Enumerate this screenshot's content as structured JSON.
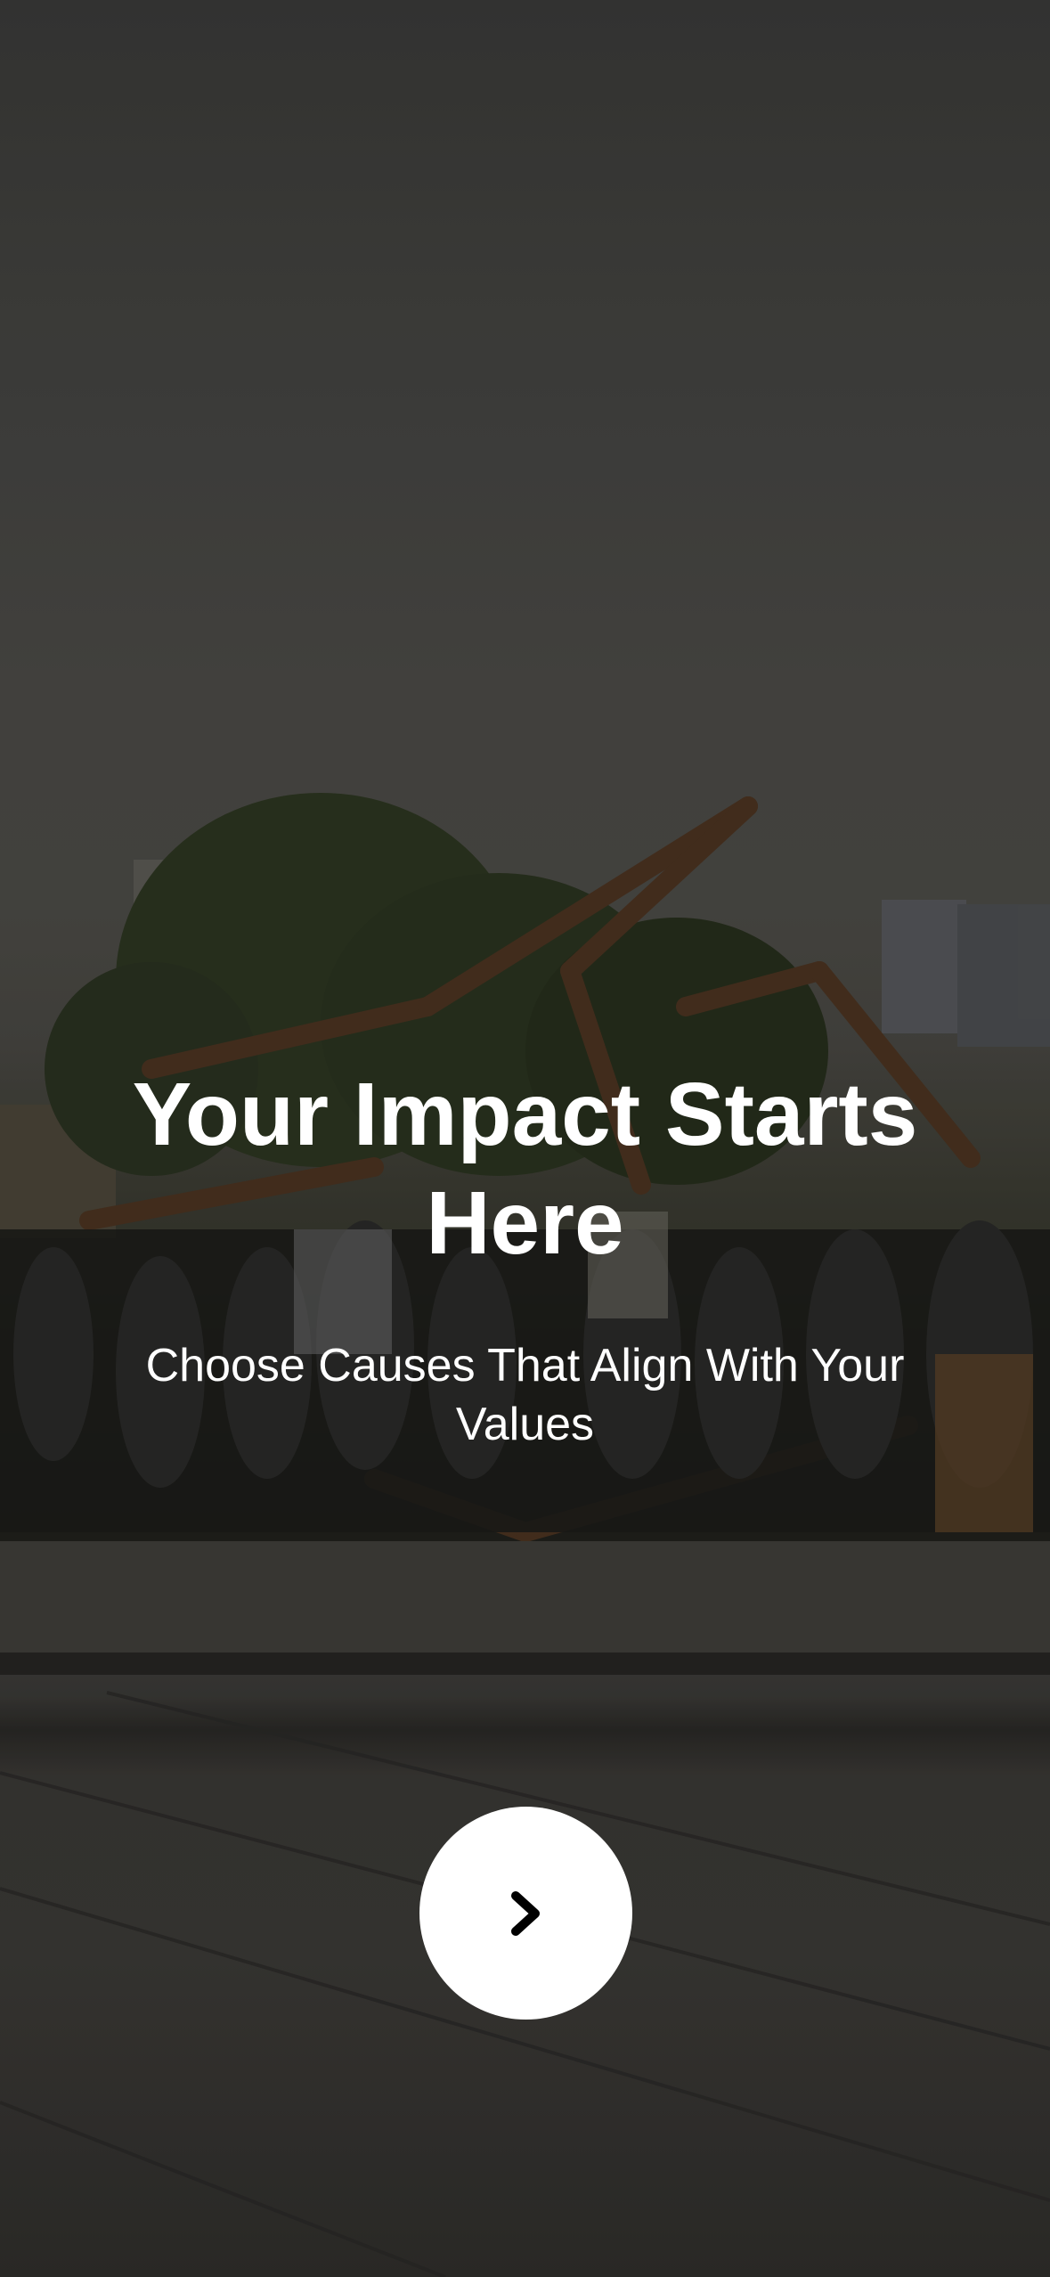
{
  "onboarding": {
    "headline": "Your Impact Starts Here",
    "subheadline": "Choose Causes That Align With Your Values",
    "next_button": {
      "icon": "chevron-right-icon",
      "background_color": "#ffffff",
      "icon_color": "#000000"
    }
  },
  "background_image": {
    "subject": "photo"
  }
}
